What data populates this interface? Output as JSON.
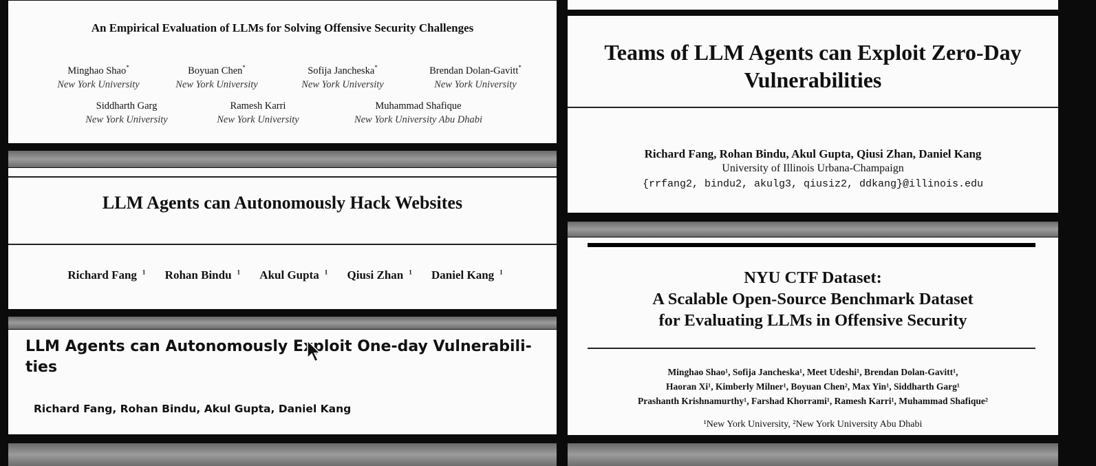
{
  "papers": {
    "empirical": {
      "title": "An Empirical Evaluation of LLMs for Solving Offensive Security Challenges",
      "authors": [
        {
          "name": "Minghao Shao",
          "mark": "*",
          "affiliation": "New York University"
        },
        {
          "name": "Boyuan Chen",
          "mark": "*",
          "affiliation": "New York University"
        },
        {
          "name": "Sofija Jancheska",
          "mark": "*",
          "affiliation": "New York University"
        },
        {
          "name": "Brendan Dolan-Gavitt",
          "mark": "*",
          "affiliation": "New York University"
        },
        {
          "name": "Siddharth Garg",
          "mark": "",
          "affiliation": "New York University"
        },
        {
          "name": "Ramesh Karri",
          "mark": "",
          "affiliation": "New York University"
        },
        {
          "name": "Muhammad Shafique",
          "mark": "",
          "affiliation": "New York University Abu Dhabi"
        }
      ]
    },
    "hack_websites": {
      "title": "LLM Agents can Autonomously Hack Websites",
      "authors": [
        {
          "name": "Richard Fang",
          "mark": "1"
        },
        {
          "name": "Rohan Bindu",
          "mark": "1"
        },
        {
          "name": "Akul Gupta",
          "mark": "1"
        },
        {
          "name": "Qiusi Zhan",
          "mark": "1"
        },
        {
          "name": "Daniel Kang",
          "mark": "1"
        }
      ]
    },
    "one_day": {
      "title": "LLM Agents can Autonomously Exploit One-day Vulnerabili-ties",
      "authors": "Richard Fang, Rohan Bindu, Akul Gupta, Daniel Kang"
    },
    "zero_day": {
      "title_line1": "Teams of LLM Agents can Exploit Zero-Day",
      "title_line2": "Vulnerabilities",
      "authors": "Richard Fang, Rohan Bindu, Akul Gupta, Qiusi Zhan, Daniel Kang",
      "affiliation": "University of Illinois Urbana-Champaign",
      "email": "{rrfang2, bindu2, akulg3, qiusiz2, ddkang}@illinois.edu"
    },
    "nyu_ctf": {
      "title_line1": "NYU CTF Dataset:",
      "title_line2": "A Scalable Open-Source Benchmark Dataset",
      "title_line3": "for Evaluating LLMs in Offensive Security",
      "author_line1": "Minghao Shao¹, Sofija Jancheska¹, Meet Udeshi¹, Brendan Dolan-Gavitt¹,",
      "author_line2": "Haoran Xi¹, Kimberly Milner¹, Boyuan Chen², Max Yin¹, Siddharth Garg¹",
      "author_line3": "Prashanth Krishnamurthy¹, Farshad Khorrami¹, Ramesh Karri¹, Muhammad Shafique²",
      "affiliations": "¹New York University, ²New York University Abu Dhabi"
    }
  }
}
